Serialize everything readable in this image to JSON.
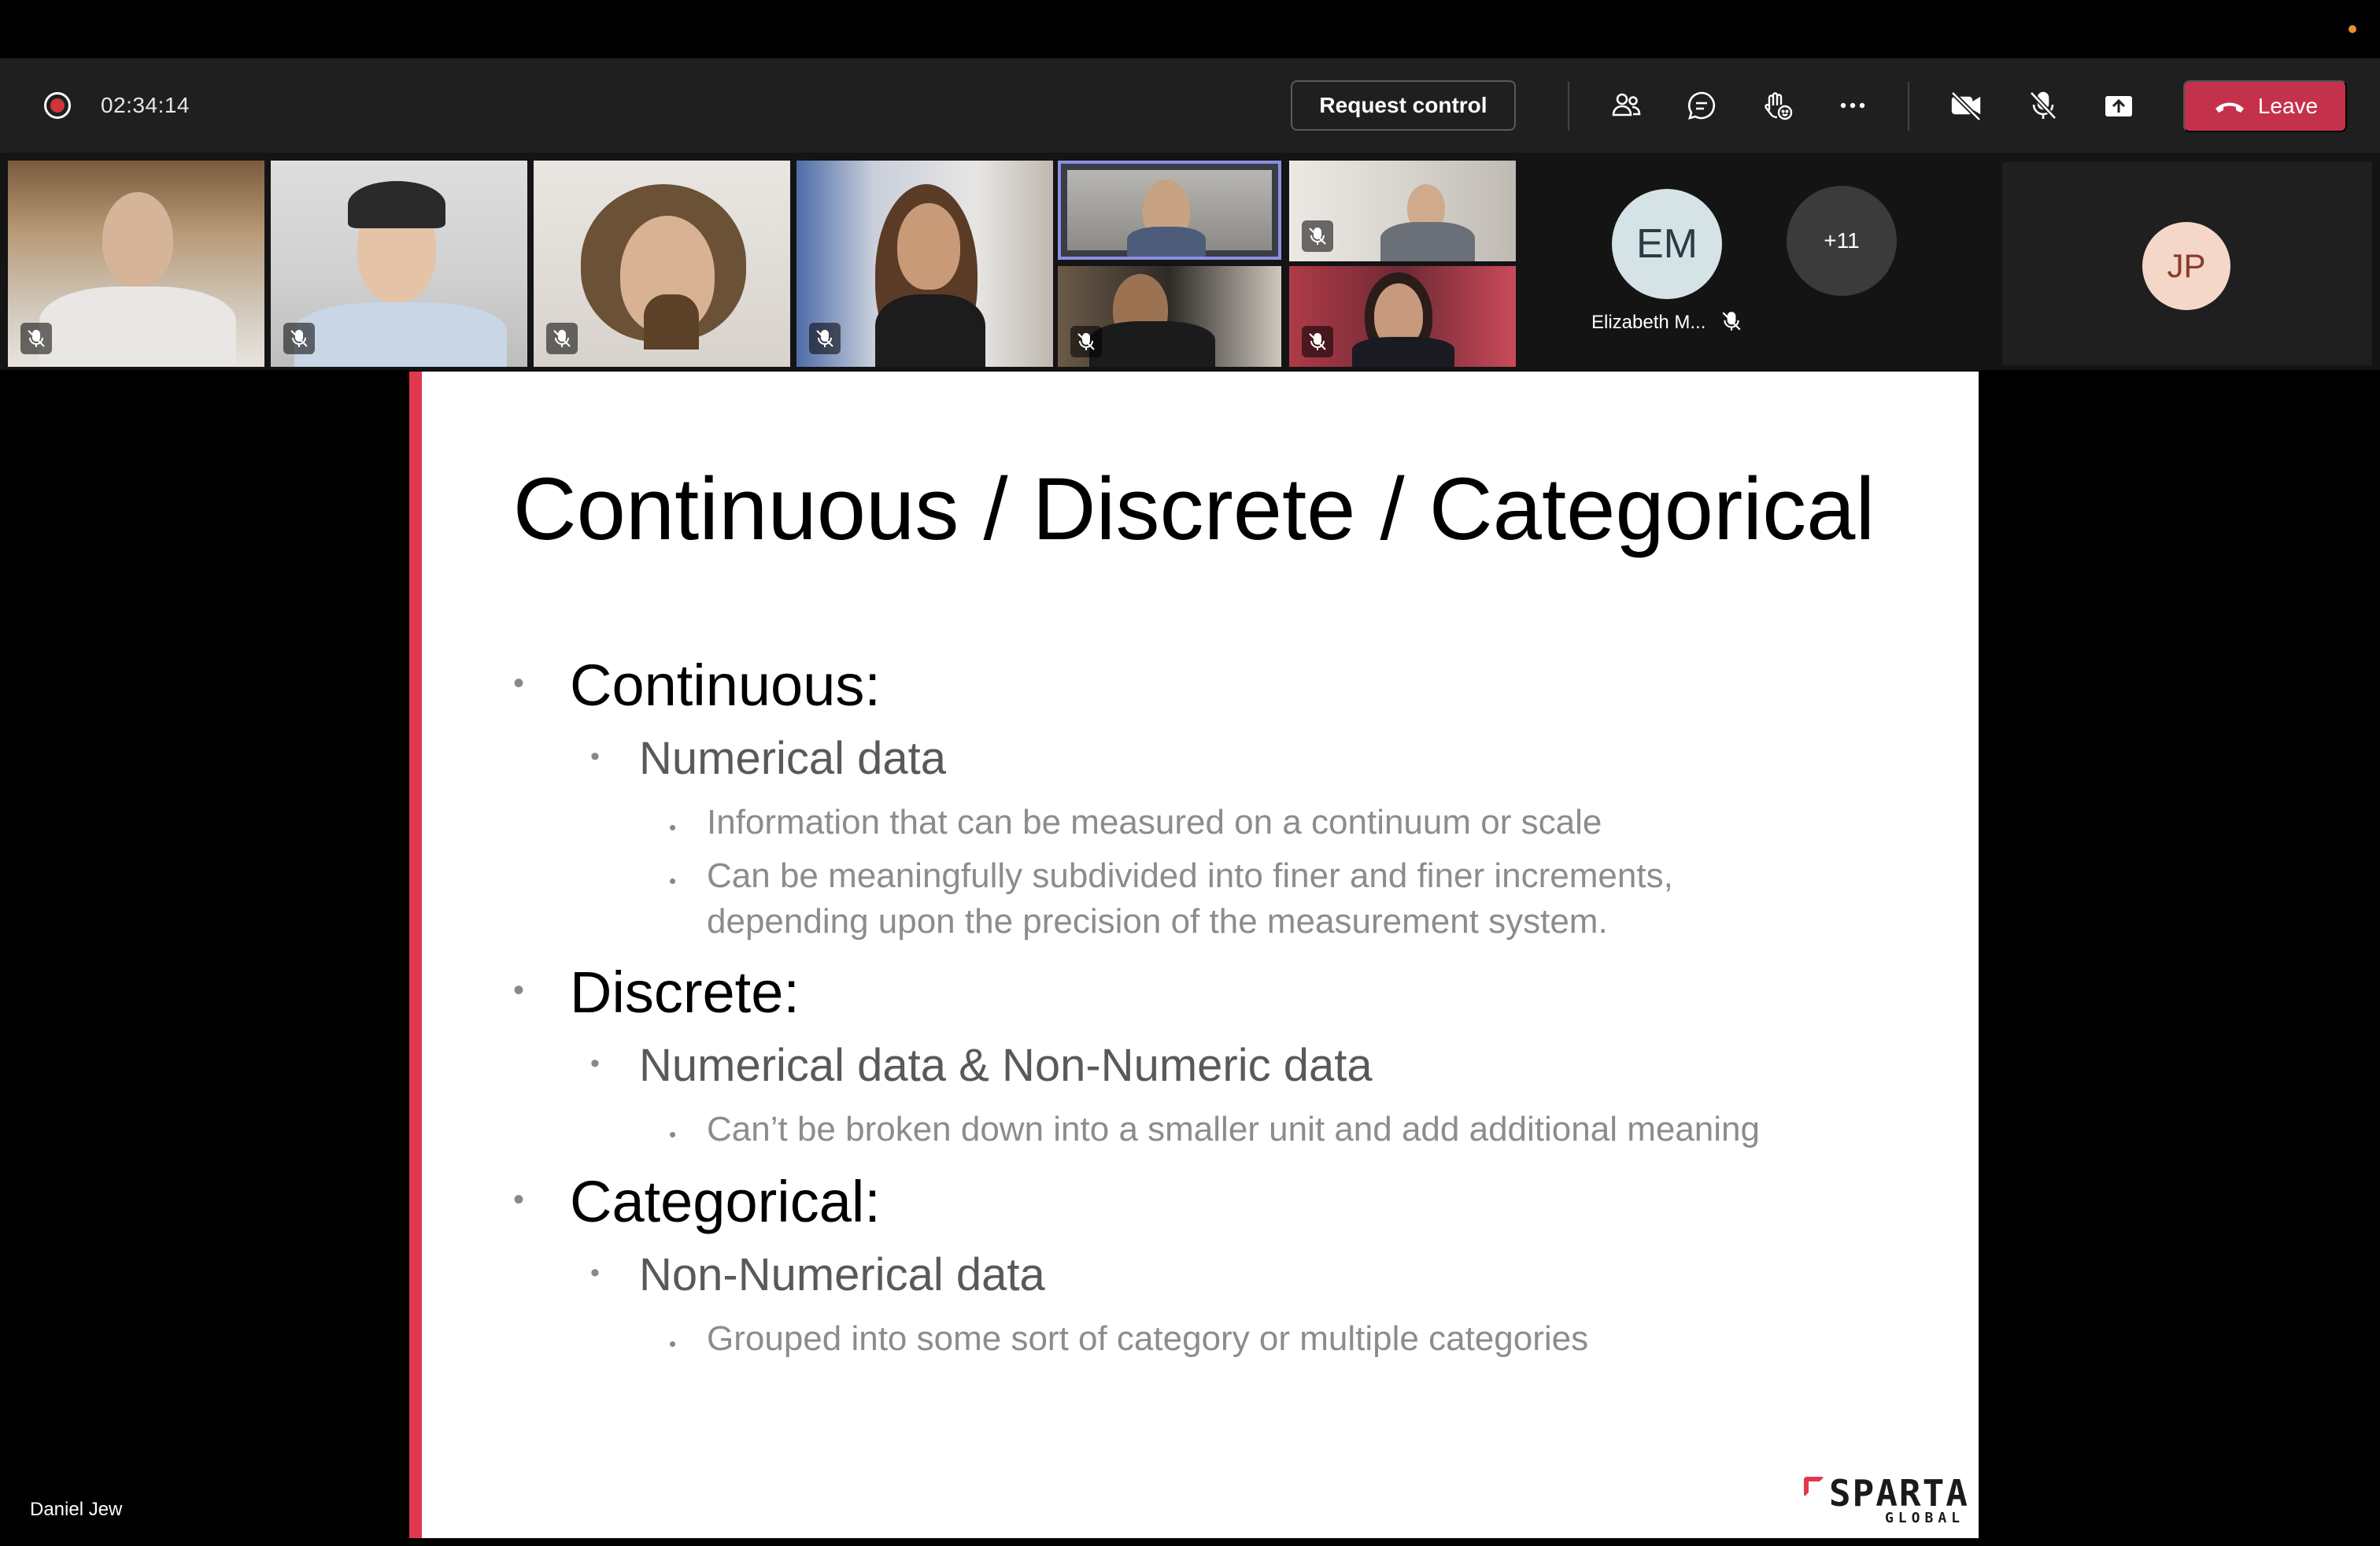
{
  "window": {
    "status_dot_color": "#e8912d"
  },
  "toolbar": {
    "timer": "02:34:14",
    "request_control_label": "Request control",
    "leave_label": "Leave",
    "icons": [
      "participants-icon",
      "chat-icon",
      "react-icon",
      "more-options-icon",
      "camera-off-icon",
      "mic-off-icon",
      "share-tray-icon"
    ],
    "accent": "#c4314b"
  },
  "gallery": {
    "participants_shown": [
      {
        "id": "tile-1",
        "muted": true
      },
      {
        "id": "tile-2",
        "muted": true
      },
      {
        "id": "tile-3",
        "muted": true
      },
      {
        "id": "tile-4",
        "muted": true
      },
      {
        "id": "tile-5",
        "muted": false,
        "speaking": true
      },
      {
        "id": "tile-6",
        "muted": true
      },
      {
        "id": "tile-7",
        "muted": true
      },
      {
        "id": "tile-8",
        "muted": true
      }
    ],
    "em": {
      "initials": "EM",
      "name": "Elizabeth M..."
    },
    "overflow_label": "+11",
    "jp": {
      "initials": "JP"
    }
  },
  "slide": {
    "title": "Continuous / Discrete / Categorical",
    "continuous": {
      "heading": "Continuous:",
      "sub": "Numerical data",
      "points": [
        "Information that can be measured on a continuum or scale",
        "Can be meaningfully subdivided into finer and finer increments, depending upon the precision of the measurement system."
      ]
    },
    "discrete": {
      "heading": "Discrete:",
      "sub": "Numerical data & Non-Numeric data",
      "points": [
        "Can’t be broken down into a smaller unit and add additional meaning"
      ]
    },
    "categorical": {
      "heading": "Categorical:",
      "sub": "Non-Numerical data",
      "points": [
        "Grouped into some sort of category or multiple categories"
      ]
    },
    "logo_word": "SPARTA",
    "logo_sub": "GLOBAL",
    "accent": "#e0394f"
  },
  "presenter": {
    "name": "Daniel Jew"
  }
}
